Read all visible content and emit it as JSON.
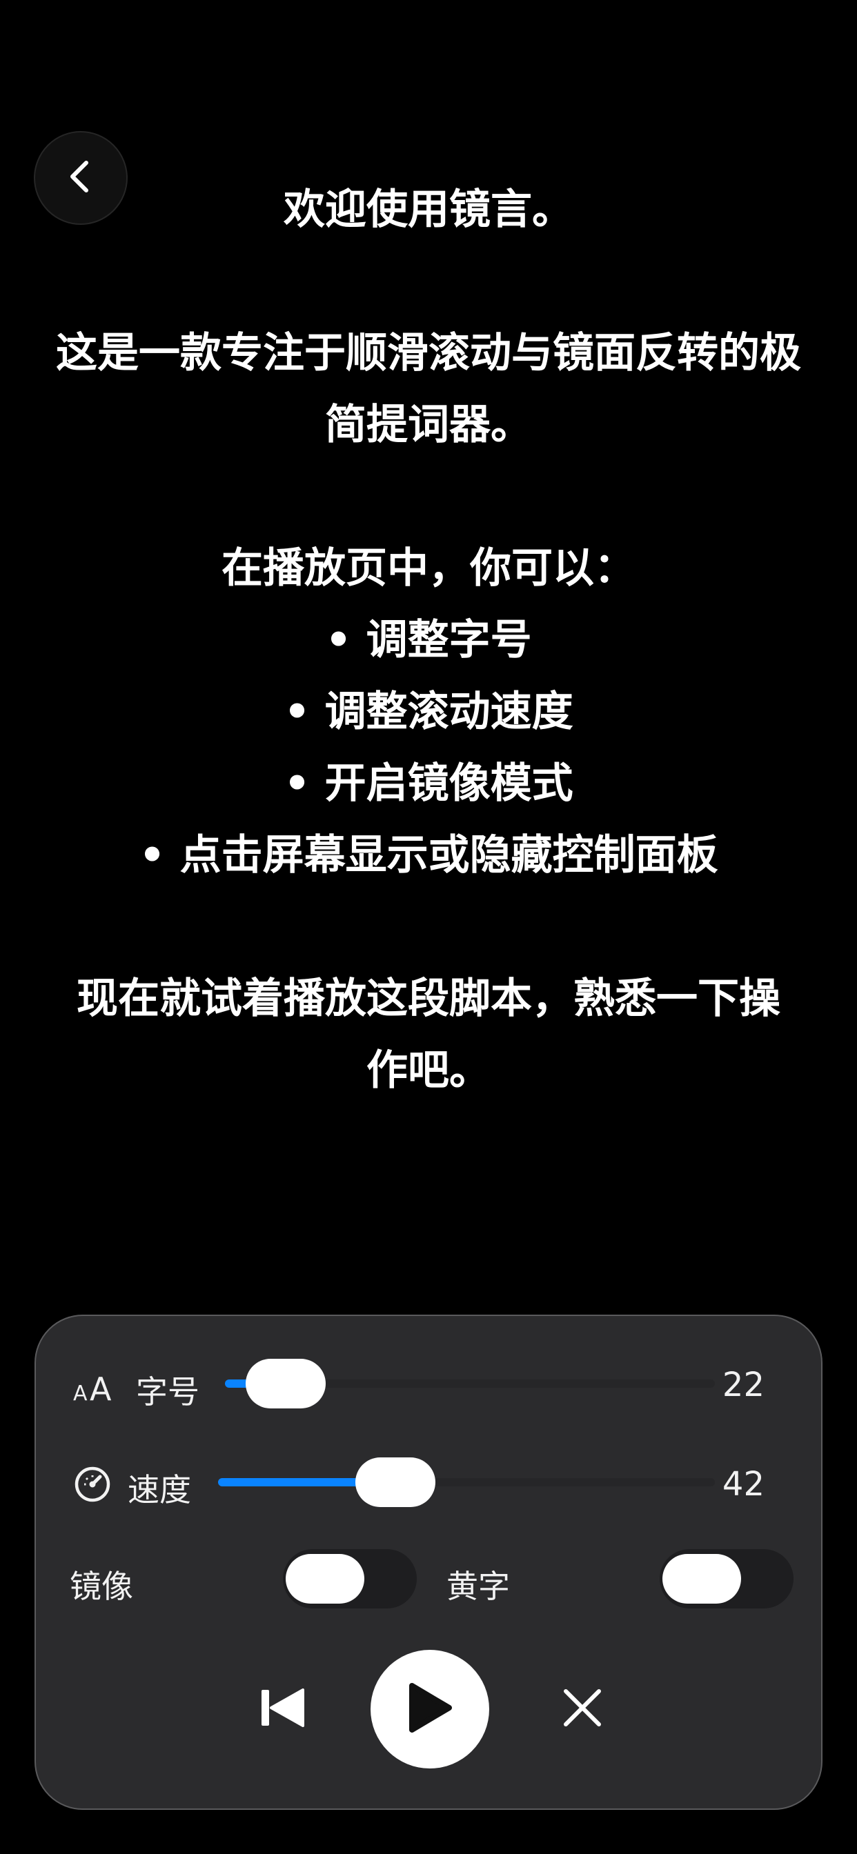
{
  "nav": {
    "back_icon": "chevron-left-icon"
  },
  "script": {
    "lines": [
      "欢迎使用镜言。",
      "",
      "这是一款专注于顺滑滚动与镜面反转的极",
      "简提词器。",
      "",
      "在播放页中，你可以：",
      "• 调整字号",
      "• 调整滚动速度",
      "• 开启镜像模式",
      "• 点击屏幕显示或隐藏控制面板",
      "",
      "现在就试着播放这段脚本，熟悉一下操",
      "作吧。"
    ]
  },
  "controls": {
    "font_size": {
      "icon": "font-size-icon",
      "label": "字号",
      "value": "22",
      "level": 0.05
    },
    "speed": {
      "icon": "speedometer-icon",
      "label": "速度",
      "value": "42",
      "level": 0.33
    },
    "mirror": {
      "label": "镜像",
      "on": false
    },
    "yellow_text": {
      "label": "黄字",
      "on": false
    },
    "playback": {
      "rewind_icon": "skip-to-start-icon",
      "play_icon": "play-icon",
      "close_icon": "close-icon"
    }
  },
  "colors": {
    "background": "#000000",
    "panel": "#2b2b2d",
    "accent": "#0a84ff",
    "text": "#ffffff"
  }
}
